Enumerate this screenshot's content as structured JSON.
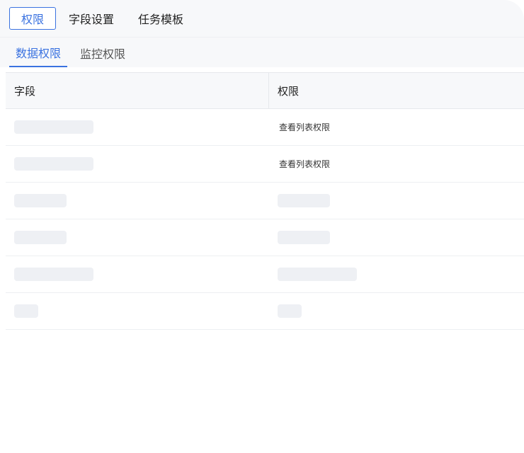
{
  "top_tabs": [
    {
      "label": "权限",
      "active": true
    },
    {
      "label": "字段设置",
      "active": false
    },
    {
      "label": "任务模板",
      "active": false
    }
  ],
  "sub_tabs": [
    {
      "label": "数据权限",
      "active": true
    },
    {
      "label": "监控权限",
      "active": false
    }
  ],
  "table": {
    "headers": {
      "field": "字段",
      "permission": "权限"
    },
    "rows": [
      {
        "permission": "查看列表权限"
      },
      {
        "permission": "查看列表权限"
      }
    ]
  },
  "colors": {
    "accent": "#3a72e0",
    "header_bg": "#f7f8fa",
    "skeleton": "#eef0f4"
  }
}
